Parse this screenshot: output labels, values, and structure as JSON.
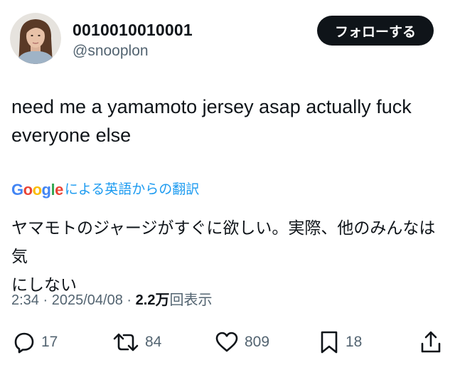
{
  "user": {
    "display_name": "0010010010001",
    "handle": "@snooplon",
    "avatar_icon": "profile-photo"
  },
  "follow_button": {
    "label": "フォローする"
  },
  "tweet": {
    "line1": "need me a yamamoto jersey asap actually fuck",
    "line2": "everyone else"
  },
  "translation": {
    "provider_logo_letters": [
      "G",
      "o",
      "o",
      "g",
      "l",
      "e"
    ],
    "provider_logo_colors": [
      "#4285F4",
      "#EA4335",
      "#FBBC05",
      "#4285F4",
      "#34A853",
      "#EA4335"
    ],
    "label": "による英語からの翻訳",
    "line1": "ヤマモトのジャージがすぐに欲しい。実際、他のみんなは気",
    "line2": "にしない"
  },
  "meta": {
    "time": "2:34",
    "separator": "·",
    "date": "2025/04/08",
    "views_count": "2.2万",
    "views_label": "回表示"
  },
  "actions": {
    "reply": {
      "icon": "reply-icon",
      "count": "17"
    },
    "retweet": {
      "icon": "retweet-icon",
      "count": "84"
    },
    "like": {
      "icon": "heart-icon",
      "count": "809"
    },
    "bookmark": {
      "icon": "bookmark-icon",
      "count": "18"
    },
    "share": {
      "icon": "share-icon"
    }
  },
  "colors": {
    "text_primary": "#0f1419",
    "text_secondary": "#536471",
    "link_blue": "#1d9bf0",
    "button_bg": "#0f1419"
  }
}
